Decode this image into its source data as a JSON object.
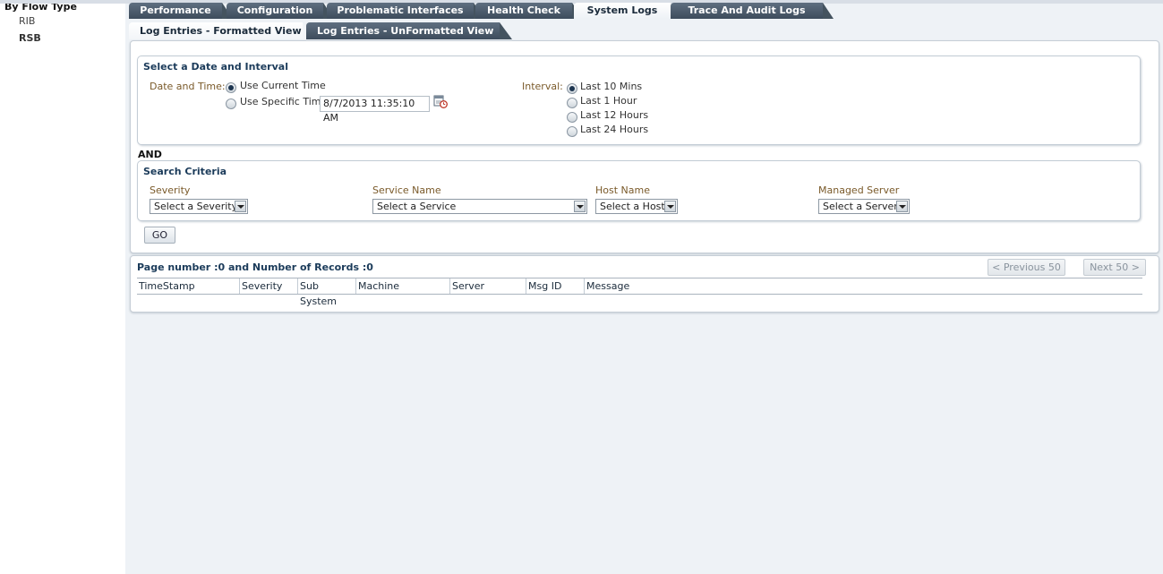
{
  "sidebar": {
    "title": "By Flow Type",
    "items": [
      {
        "label": "RIB",
        "selected": false
      },
      {
        "label": "RSB",
        "selected": true
      }
    ]
  },
  "tabs": [
    {
      "label": "Performance",
      "active": false
    },
    {
      "label": "Configuration",
      "active": false
    },
    {
      "label": "Problematic Interfaces",
      "active": false
    },
    {
      "label": "Health Check",
      "active": false
    },
    {
      "label": "System Logs",
      "active": true
    },
    {
      "label": "Trace And Audit Logs",
      "active": false
    }
  ],
  "subtabs": [
    {
      "label": "Log Entries - Formatted View",
      "active": true
    },
    {
      "label": "Log Entries - UnFormatted View",
      "active": false
    }
  ],
  "date_interval": {
    "title": "Select a Date and Interval",
    "date_label": "Date and Time:",
    "options": [
      {
        "label": "Use Current Time",
        "selected": true
      },
      {
        "label": "Use Specific Time",
        "selected": false
      }
    ],
    "specific_time_value": "8/7/2013 11:35:10 AM",
    "calendar_icon": "calendar-clock-icon",
    "interval_label": "Interval:",
    "intervals": [
      {
        "label": "Last 10 Mins",
        "selected": true
      },
      {
        "label": "Last 1 Hour",
        "selected": false
      },
      {
        "label": "Last 12 Hours",
        "selected": false
      },
      {
        "label": "Last 24 Hours",
        "selected": false
      }
    ]
  },
  "and_label": "AND",
  "search": {
    "title": "Search Criteria",
    "severity_label": "Severity",
    "severity_value": "Select a Severity",
    "service_label": "Service Name",
    "service_value": "Select a Service",
    "host_label": "Host Name",
    "host_value": "Select a Host",
    "server_label": "Managed Server",
    "server_value": "Select a Server",
    "go_label": "GO"
  },
  "results": {
    "records_text": "Page number :0 and Number of Records :0",
    "prev_label": "< Previous 50",
    "next_label": "Next 50 >",
    "columns": [
      "TimeStamp",
      "Severity",
      "Sub System",
      "Machine",
      "Server",
      "Msg ID",
      "Message"
    ]
  },
  "colors": {
    "tab_dark": "#3d4c5c",
    "title_blue": "#1b3b5a",
    "label_brown": "#7a5a2a",
    "background": "#eef2f6"
  }
}
